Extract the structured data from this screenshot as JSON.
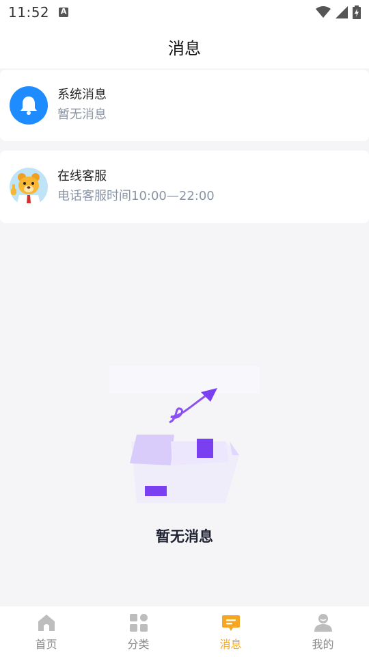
{
  "status_bar": {
    "time": "11:52"
  },
  "header": {
    "title": "消息"
  },
  "cards": [
    {
      "title": "系统消息",
      "subtitle": "暂无消息",
      "icon": "bell-icon",
      "icon_color": "#1e8cff"
    },
    {
      "title": "在线客服",
      "subtitle": "电话客服时间10:00—22:00",
      "icon": "bear-mascot-avatar"
    }
  ],
  "empty_state": {
    "text": "暂无消息",
    "accent_color": "#7b3ff2"
  },
  "tabs": [
    {
      "label": "首页",
      "icon": "home-icon",
      "active": false
    },
    {
      "label": "分类",
      "icon": "category-icon",
      "active": false
    },
    {
      "label": "消息",
      "icon": "message-icon",
      "active": true
    },
    {
      "label": "我的",
      "icon": "profile-icon",
      "active": false
    }
  ],
  "colors": {
    "active_tab": "#f5a623",
    "inactive_tab": "#bdbdbd"
  }
}
